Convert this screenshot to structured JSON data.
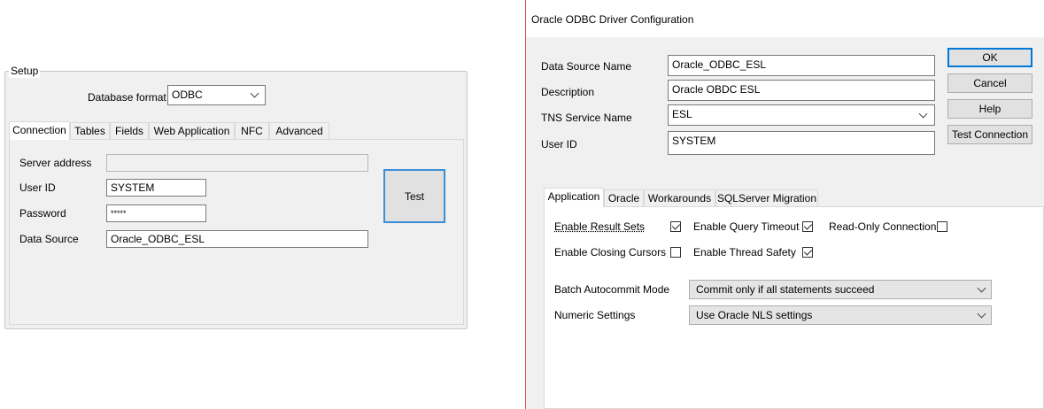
{
  "setup": {
    "group_label": "Setup",
    "database_format_label": "Database format",
    "database_format_value": "ODBC",
    "tabs": [
      {
        "label": "Connection",
        "active": true
      },
      {
        "label": "Tables"
      },
      {
        "label": "Fields"
      },
      {
        "label": "Web Application"
      },
      {
        "label": "NFC"
      },
      {
        "label": "Advanced"
      }
    ],
    "server_address_label": "Server address",
    "server_address_value": "",
    "user_id_label": "User ID",
    "user_id_value": "SYSTEM",
    "password_label": "Password",
    "password_value": "*****",
    "data_source_label": "Data Source",
    "data_source_value": "Oracle_ODBC_ESL",
    "test_label": "Test"
  },
  "oracle": {
    "window_title": "Oracle ODBC Driver Configuration",
    "data_source_name_label": "Data Source Name",
    "data_source_name_value": "Oracle_ODBC_ESL",
    "description_label": "Description",
    "description_value": "Oracle OBDC ESL",
    "tns_label": "TNS Service Name",
    "tns_value": "ESL",
    "user_id_label": "User ID",
    "user_id_value": "SYSTEM",
    "buttons": {
      "ok": "OK",
      "cancel": "Cancel",
      "help": "Help",
      "test_connection": "Test Connection"
    },
    "tabs": [
      {
        "label": "Application",
        "active": true
      },
      {
        "label": "Oracle"
      },
      {
        "label": "Workarounds"
      },
      {
        "label": "SQLServer Migration"
      }
    ],
    "checks": {
      "enable_result_sets": {
        "label": "Enable Result Sets",
        "checked": true
      },
      "enable_query_timeout": {
        "label": "Enable Query Timeout",
        "checked": true
      },
      "read_only_connection": {
        "label": "Read-Only Connection",
        "checked": false
      },
      "enable_closing_cursors": {
        "label": "Enable Closing Cursors",
        "checked": false
      },
      "enable_thread_safety": {
        "label": "Enable Thread Safety",
        "checked": true
      }
    },
    "batch_autocommit_label": "Batch Autocommit Mode",
    "batch_autocommit_value": "Commit only if all statements succeed",
    "numeric_settings_label": "Numeric Settings",
    "numeric_settings_value": "Use Oracle NLS settings"
  },
  "colors": {
    "accent": "#0078d7",
    "window_border": "#d9534f",
    "panel": "#f0f0f0"
  }
}
